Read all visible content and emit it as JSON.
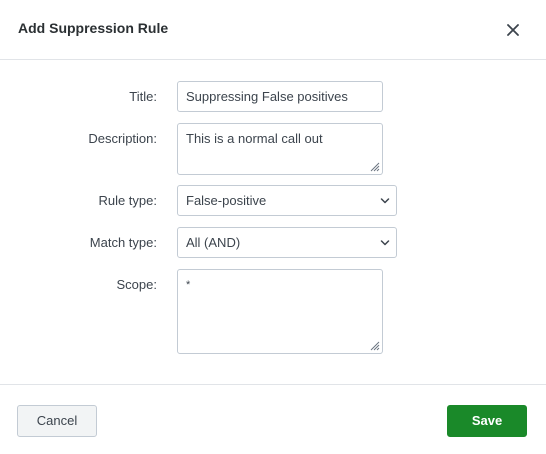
{
  "dialog": {
    "title": "Add Suppression Rule",
    "close_icon": "close-icon"
  },
  "form": {
    "title_label": "Title:",
    "title_value": "Suppressing False positives",
    "description_label": "Description:",
    "description_value": "This is a normal call out",
    "rule_type_label": "Rule type:",
    "rule_type_value": "False-positive",
    "match_type_label": "Match type:",
    "match_type_value": "All (AND)",
    "scope_label": "Scope:",
    "scope_value": "*"
  },
  "footer": {
    "cancel_label": "Cancel",
    "save_label": "Save"
  },
  "colors": {
    "save_button": "#1a8929",
    "cancel_button": "#f2f4f5",
    "field_border": "#c3cbd4"
  }
}
